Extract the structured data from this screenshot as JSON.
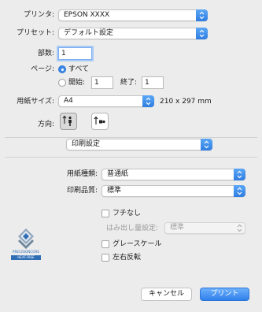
{
  "printer": {
    "label": "プリンタ:",
    "value": "EPSON XXXX"
  },
  "preset": {
    "label": "プリセット:",
    "value": "デフォルト設定"
  },
  "copies": {
    "label": "部数:",
    "value": "1"
  },
  "pages": {
    "label": "ページ:",
    "all_label": "すべて",
    "from_label": "開始:",
    "from_value": "1",
    "to_label": "終了:",
    "to_value": "1",
    "selected": "all"
  },
  "paper_size": {
    "label": "用紙サイズ:",
    "value": "A4",
    "dimensions": "210 x 297 mm"
  },
  "orientation": {
    "label": "方向:",
    "selected": "portrait"
  },
  "section": {
    "value": "印刷設定"
  },
  "media_type": {
    "label": "用紙種類:",
    "value": "普通紙"
  },
  "print_quality": {
    "label": "印刷品質:",
    "value": "標準"
  },
  "borderless": {
    "label": "フチなし",
    "checked": false
  },
  "expansion": {
    "label": "はみ出し量設定:",
    "value": "標準"
  },
  "grayscale": {
    "label": "グレースケール",
    "checked": false
  },
  "mirror": {
    "label": "左右反転",
    "checked": false
  },
  "logo": {
    "line1": "PRECISIONCORE",
    "line2": "HEAT-FREE"
  },
  "buttons": {
    "cancel": "キャンセル",
    "print": "プリント"
  },
  "colors": {
    "accent": "#3b88e8",
    "background": "#ececec",
    "logo_blue": "#2f6eb5"
  }
}
